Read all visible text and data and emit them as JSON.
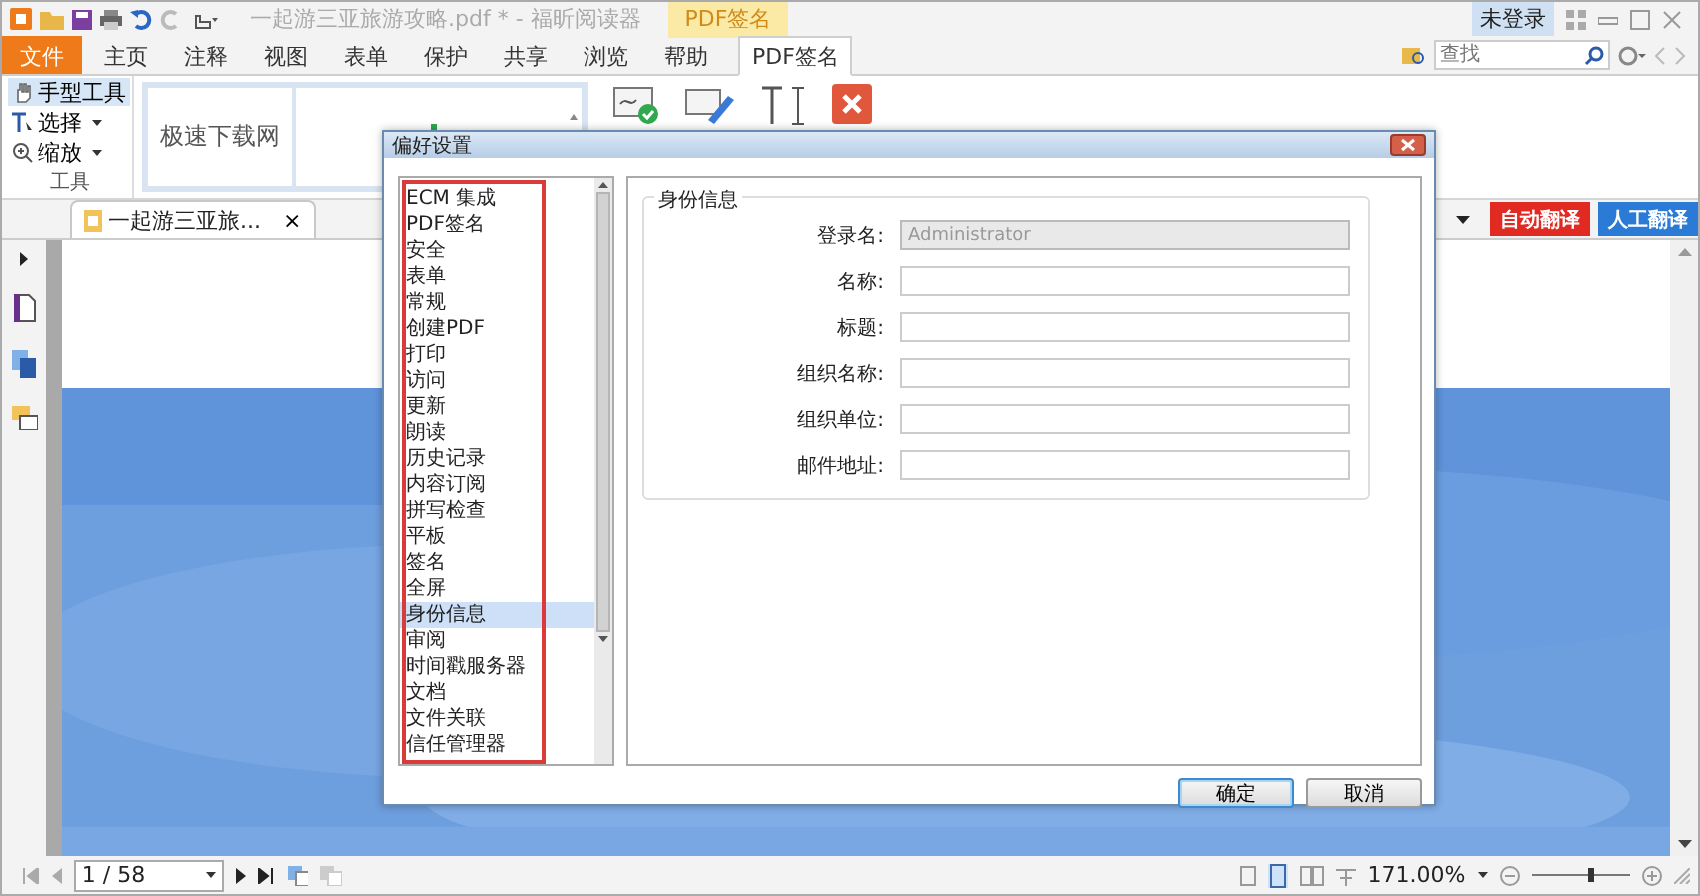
{
  "title_bar": {
    "title": "一起游三亚旅游攻略.pdf * - 福昕阅读器",
    "context_tab": "PDF签名",
    "account": "未登录"
  },
  "menu_tabs": [
    {
      "label": "文件",
      "kind": "file",
      "selected": false
    },
    {
      "label": "主页",
      "kind": "tab",
      "selected": false
    },
    {
      "label": "注释",
      "kind": "tab",
      "selected": false
    },
    {
      "label": "视图",
      "kind": "tab",
      "selected": false
    },
    {
      "label": "表单",
      "kind": "tab",
      "selected": false
    },
    {
      "label": "保护",
      "kind": "tab",
      "selected": false
    },
    {
      "label": "共享",
      "kind": "tab",
      "selected": false
    },
    {
      "label": "浏览",
      "kind": "tab",
      "selected": false
    },
    {
      "label": "帮助",
      "kind": "tab",
      "selected": false
    },
    {
      "label": "PDF签名",
      "kind": "tab",
      "selected": true
    }
  ],
  "search": {
    "placeholder": "查找"
  },
  "ribbon": {
    "tools": [
      {
        "label": "手型工具",
        "kind": "hand",
        "selected": true,
        "dropdown": false
      },
      {
        "label": "选择",
        "kind": "select",
        "selected": false,
        "dropdown": true
      },
      {
        "label": "缩放",
        "kind": "zoom",
        "selected": false,
        "dropdown": true
      }
    ],
    "group_label": "工具",
    "signatures": [
      "极速下载网"
    ]
  },
  "document_tab": {
    "title": "一起游三亚旅...",
    "close": "×"
  },
  "translate_buttons": [
    {
      "label": "自动翻译",
      "color": "#e02a22"
    },
    {
      "label": "人工翻译",
      "color": "#2a7ad6"
    }
  ],
  "dialog": {
    "title": "偏好设置",
    "categories": [
      {
        "label": "ECM 集成",
        "selected": false
      },
      {
        "label": "PDF签名",
        "selected": false
      },
      {
        "label": "安全",
        "selected": false
      },
      {
        "label": "表单",
        "selected": false
      },
      {
        "label": "常规",
        "selected": false
      },
      {
        "label": "创建PDF",
        "selected": false
      },
      {
        "label": "打印",
        "selected": false
      },
      {
        "label": "访问",
        "selected": false
      },
      {
        "label": "更新",
        "selected": false
      },
      {
        "label": "朗读",
        "selected": false
      },
      {
        "label": "历史记录",
        "selected": false
      },
      {
        "label": "内容订阅",
        "selected": false
      },
      {
        "label": "拼写检查",
        "selected": false
      },
      {
        "label": "平板",
        "selected": false
      },
      {
        "label": "签名",
        "selected": false
      },
      {
        "label": "全屏",
        "selected": false
      },
      {
        "label": "身份信息",
        "selected": true
      },
      {
        "label": "审阅",
        "selected": false
      },
      {
        "label": "时间戳服务器",
        "selected": false
      },
      {
        "label": "文档",
        "selected": false
      },
      {
        "label": "文件关联",
        "selected": false
      },
      {
        "label": "信任管理器",
        "selected": false
      }
    ],
    "group_title": "身份信息",
    "fields": [
      {
        "label": "登录名:",
        "value": "Administrator",
        "disabled": true
      },
      {
        "label": "名称:",
        "disabled": false
      },
      {
        "label": "标题:",
        "disabled": false
      },
      {
        "label": "组织名称:",
        "disabled": false
      },
      {
        "label": "组织单位:",
        "disabled": false
      },
      {
        "label": "邮件地址:",
        "disabled": false
      }
    ],
    "buttons": [
      {
        "label": "确定",
        "default": true
      },
      {
        "label": "取消",
        "default": false
      }
    ]
  },
  "status_bar": {
    "page": "1 / 58",
    "zoom": "171.00%",
    "zoom_slider": {
      "level": 0.6
    }
  }
}
